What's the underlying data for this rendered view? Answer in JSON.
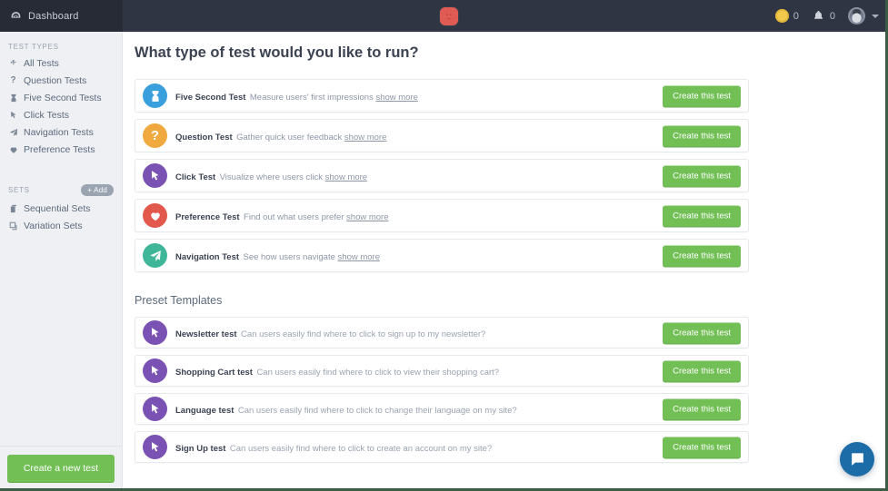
{
  "header": {
    "dashboard_label": "Dashboard",
    "dashboard_icon": "dashboard-gauge-icon",
    "brand_icon": "app-logo-icon",
    "credits_count": "0",
    "credits_icon": "coin-icon",
    "notifications_count": "0",
    "notifications_icon": "bell-icon",
    "avatar_icon": "user-avatar",
    "caret_icon": "chevron-down-icon",
    "colors": {
      "bar": "#2f3542",
      "bar_left": "#262b36",
      "brand": "#e15b55",
      "coin": "#f2c94c"
    }
  },
  "sidebar": {
    "test_types_title": "TEST TYPES",
    "sets_title": "SETS",
    "add_label": "+ Add",
    "test_types": [
      {
        "label": "All Tests",
        "icon": "arrows-move-icon"
      },
      {
        "label": "Question Tests",
        "icon": "question-mark-icon"
      },
      {
        "label": "Five Second Tests",
        "icon": "hourglass-icon"
      },
      {
        "label": "Click Tests",
        "icon": "cursor-arrow-icon"
      },
      {
        "label": "Navigation Tests",
        "icon": "paper-plane-icon"
      },
      {
        "label": "Preference Tests",
        "icon": "heart-icon"
      }
    ],
    "sets": [
      {
        "label": "Sequential Sets",
        "icon": "copy-stack-icon"
      },
      {
        "label": "Variation Sets",
        "icon": "variation-box-icon"
      }
    ],
    "new_test_button": "Create a new test",
    "colors": {
      "bg": "#eef0f4",
      "green": "#72bf56"
    }
  },
  "main": {
    "page_title": "What type of test would you like to run?",
    "preset_section_title": "Preset Templates",
    "create_button_label": "Create this test",
    "show_more_label": "show more",
    "test_types": [
      {
        "title": "Five Second Test",
        "desc": "Measure users' first impressions",
        "icon": "hourglass-icon",
        "color": "#3aa0dd"
      },
      {
        "title": "Question Test",
        "desc": "Gather quick user feedback",
        "icon": "question-mark-icon",
        "color": "#f0a93e"
      },
      {
        "title": "Click Test",
        "desc": "Visualize where users click",
        "icon": "cursor-arrow-icon",
        "color": "#7a52b3"
      },
      {
        "title": "Preference Test",
        "desc": "Find out what users prefer",
        "icon": "heart-icon",
        "color": "#e2584c"
      },
      {
        "title": "Navigation Test",
        "desc": "See how users navigate",
        "icon": "paper-plane-icon",
        "color": "#3fb698"
      }
    ],
    "presets": [
      {
        "title": "Newsletter test",
        "desc": "Can users easily find where to click to sign up to my newsletter?",
        "icon": "cursor-arrow-icon",
        "color": "#7a52b3"
      },
      {
        "title": "Shopping Cart test",
        "desc": "Can users easily find where to click to view their shopping cart?",
        "icon": "cursor-arrow-icon",
        "color": "#7a52b3"
      },
      {
        "title": "Language test",
        "desc": "Can users easily find where to click to change their language on my site?",
        "icon": "cursor-arrow-icon",
        "color": "#7a52b3"
      },
      {
        "title": "Sign Up test",
        "desc": "Can users easily find where to click to create an account on my site?",
        "icon": "cursor-arrow-icon",
        "color": "#7a52b3"
      }
    ]
  },
  "chat": {
    "icon": "chat-bubble-icon",
    "color": "#1c6ca8"
  }
}
